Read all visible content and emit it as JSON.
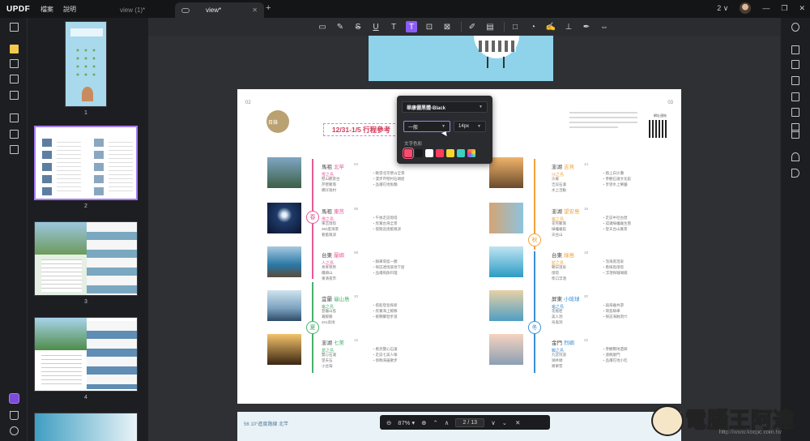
{
  "app": {
    "logo": "UPDF"
  },
  "menu": {
    "file": "檔案",
    "help": "說明"
  },
  "tabs": [
    {
      "label": "view (1)*"
    },
    {
      "label": "view*"
    }
  ],
  "window": {
    "page_count_badge": "2",
    "chevron": "∨"
  },
  "thumbnails": [
    {
      "num": "1"
    },
    {
      "num": "2"
    },
    {
      "num": "3"
    },
    {
      "num": "4"
    }
  ],
  "page": {
    "left_num": "02",
    "right_num": "03",
    "circle_label": "目錄",
    "schedule_title": "12/31-1/5 行程參考",
    "qr_label": "網址連結",
    "seasons": {
      "spring": "春",
      "summer": "夏",
      "autumn": "秋",
      "winter": "冬"
    },
    "left_entries": [
      {
        "region": "馬祖",
        "place": "北竿",
        "code": "04",
        "sub": "雪之島",
        "left": "壁山觀景台\n芹壁聚落\n橋仔漁村",
        "right": "・眺望北竿壁山全景\n・漫步芹壁村石頭屋\n・品嚐在地魚麵"
      },
      {
        "region": "馬祖",
        "place": "東莒",
        "code": "06",
        "sub": "燈之島",
        "left": "東莒燈塔\n360度海景\n看藍眼淚",
        "right": "・午後走訪燈塔\n・欣賞台海全景\n・夜間追逐藍眼淚"
      },
      {
        "region": "台東",
        "place": "蘭嶼",
        "code": "08",
        "sub": "人之島",
        "left": "青青草原\n饅頭山\n東清夜市",
        "right": "・騎車環島一圈\n・探訪達悟族地下屋\n・品嚐飛魚料理"
      },
      {
        "region": "宜蘭",
        "place": "龜山島",
        "code": "10",
        "sub": "龜之島",
        "left": "登龜山島\n賞鯨豚\n401高地",
        "right": "・搭船登島探索\n・欣賞海上鯨豚\n・挑戰攀登步道"
      },
      {
        "region": "澎湖",
        "place": "七美",
        "code": "12",
        "sub": "愛之島",
        "left": "雙心石滬\n望夫石\n小台灣",
        "right": "・看見雙心石滬\n・走訪七美人塚\n・傍晚海邊散步"
      }
    ],
    "right_entries": [
      {
        "region": "澎湖",
        "place": "吉貝",
        "code": "14",
        "sub": "沙之島",
        "left": "沙尾\n吉貝石滬\n水上活動",
        "right": "・踏上白沙灘\n・參觀石滬文化館\n・享受水上樂園"
      },
      {
        "region": "澎湖",
        "place": "望安島",
        "code": "16",
        "sub": "龜之島",
        "left": "花宅聚落\n綠蠵龜館\n天台山",
        "right": "・走訪中社古厝\n・認識綠蠵龜生態\n・登天台山賞景"
      },
      {
        "region": "台東",
        "place": "綠島",
        "code": "18",
        "sub": "監之島",
        "left": "朝日溫泉\n燈塔\n柴口浮潛",
        "right": "・泡海底溫泉\n・看綠島燈塔\n・浮潛探珊瑚礁"
      },
      {
        "region": "屏東",
        "place": "小琉球",
        "code": "20",
        "sub": "龜之島",
        "left": "花瓶岩\n美人洞\n烏鬼洞",
        "right": "・與海龜共游\n・環島騎車\n・探訪海蝕洞穴"
      },
      {
        "region": "金門",
        "place": "烈嶼",
        "code": "22",
        "sub": "戰之島",
        "left": "九宮坑道\n湖井頭\n將軍堡",
        "right": "・參觀戰地遺跡\n・遠眺廈門\n・品嚐在地小吃"
      }
    ]
  },
  "bottom_page": {
    "text": "56  10°進度路線  北竿"
  },
  "popover": {
    "font": "華康儷黑體-Black",
    "style": "一般",
    "size": "14px",
    "color_label": "文字色彩",
    "swatches": [
      "#ff4a6e",
      "#1a1a1a",
      "#ffffff",
      "#ff3c5e",
      "#f5d72f",
      "#3ad0c3",
      "#ff8a3c"
    ]
  },
  "zoombar": {
    "zoom": "87%",
    "page": "2 / 13"
  },
  "watermark": {
    "text": "電腦王阿達",
    "url": "http://www.kocpc.com.tw"
  },
  "colors": {
    "accent": "#8b5cf6",
    "spring": "#e85a9a",
    "summer": "#48b16c",
    "autumn": "#f2a23b",
    "winter": "#3a8fd8"
  }
}
